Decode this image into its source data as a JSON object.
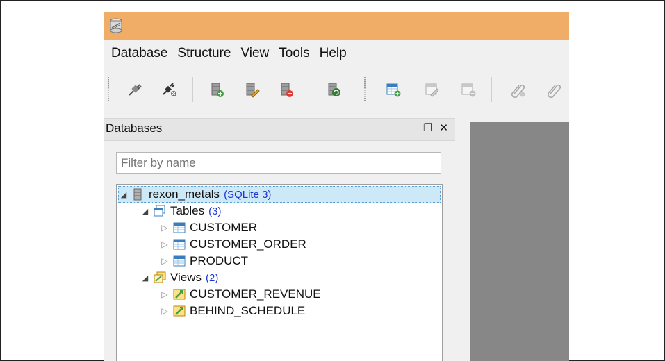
{
  "menu": [
    "Database",
    "Structure",
    "View",
    "Tools",
    "Help"
  ],
  "panel": {
    "title": "Databases",
    "float_glyph": "❐",
    "close_glyph": "✕"
  },
  "filter": {
    "placeholder": "Filter by name",
    "value": ""
  },
  "tree": {
    "database": {
      "name": "rexon_metals",
      "type": "(SQLite 3)"
    },
    "tables": {
      "label": "Tables",
      "count": "(3)",
      "items": [
        "CUSTOMER",
        "CUSTOMER_ORDER",
        "PRODUCT"
      ]
    },
    "views": {
      "label": "Views",
      "count": "(2)",
      "items": [
        "CUSTOMER_REVENUE",
        "BEHIND_SCHEDULE"
      ]
    }
  },
  "colors": {
    "titlebar": "#f0ad68",
    "editor_bg": "#878787",
    "count_text": "#1a35d6",
    "selection": "#cde8f7"
  }
}
